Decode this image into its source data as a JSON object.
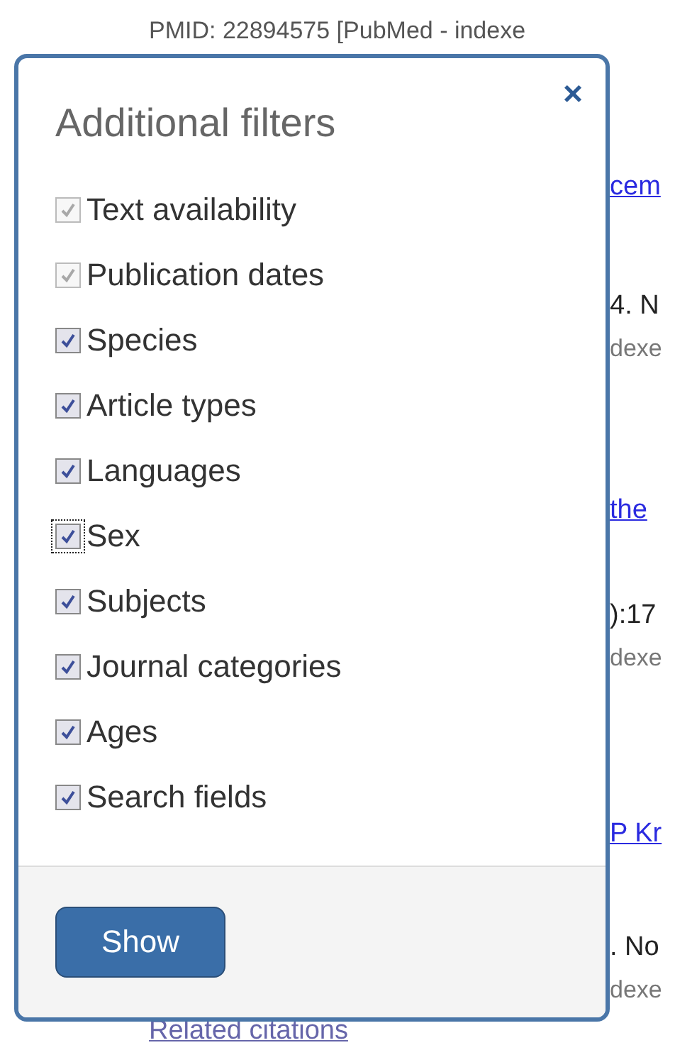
{
  "background": {
    "citation": "PMID: 22894575 [PubMed - indexe",
    "fragments": [
      {
        "kind": "link",
        "text": "cem"
      },
      {
        "kind": "text",
        "text": "4. N"
      },
      {
        "kind": "note",
        "text": "dexe"
      },
      {
        "kind": "link",
        "text": " the"
      },
      {
        "kind": "text",
        "text": "):17"
      },
      {
        "kind": "note",
        "text": "dexe"
      },
      {
        "kind": "link",
        "text": "P Kr"
      },
      {
        "kind": "text",
        "text": ". No"
      },
      {
        "kind": "note",
        "text": "dexe"
      }
    ],
    "related_link": "Related citations"
  },
  "dialog": {
    "title": "Additional filters",
    "close": "×",
    "filters": [
      {
        "label": "Text availability",
        "checked": true,
        "disabled": true,
        "focused": false
      },
      {
        "label": "Publication dates",
        "checked": true,
        "disabled": true,
        "focused": false
      },
      {
        "label": "Species",
        "checked": true,
        "disabled": false,
        "focused": false
      },
      {
        "label": "Article types",
        "checked": true,
        "disabled": false,
        "focused": false
      },
      {
        "label": "Languages",
        "checked": true,
        "disabled": false,
        "focused": false
      },
      {
        "label": "Sex",
        "checked": true,
        "disabled": false,
        "focused": true
      },
      {
        "label": "Subjects",
        "checked": true,
        "disabled": false,
        "focused": false
      },
      {
        "label": "Journal categories",
        "checked": true,
        "disabled": false,
        "focused": false
      },
      {
        "label": "Ages",
        "checked": true,
        "disabled": false,
        "focused": false
      },
      {
        "label": "Search fields",
        "checked": true,
        "disabled": false,
        "focused": false
      }
    ],
    "button": "Show"
  }
}
